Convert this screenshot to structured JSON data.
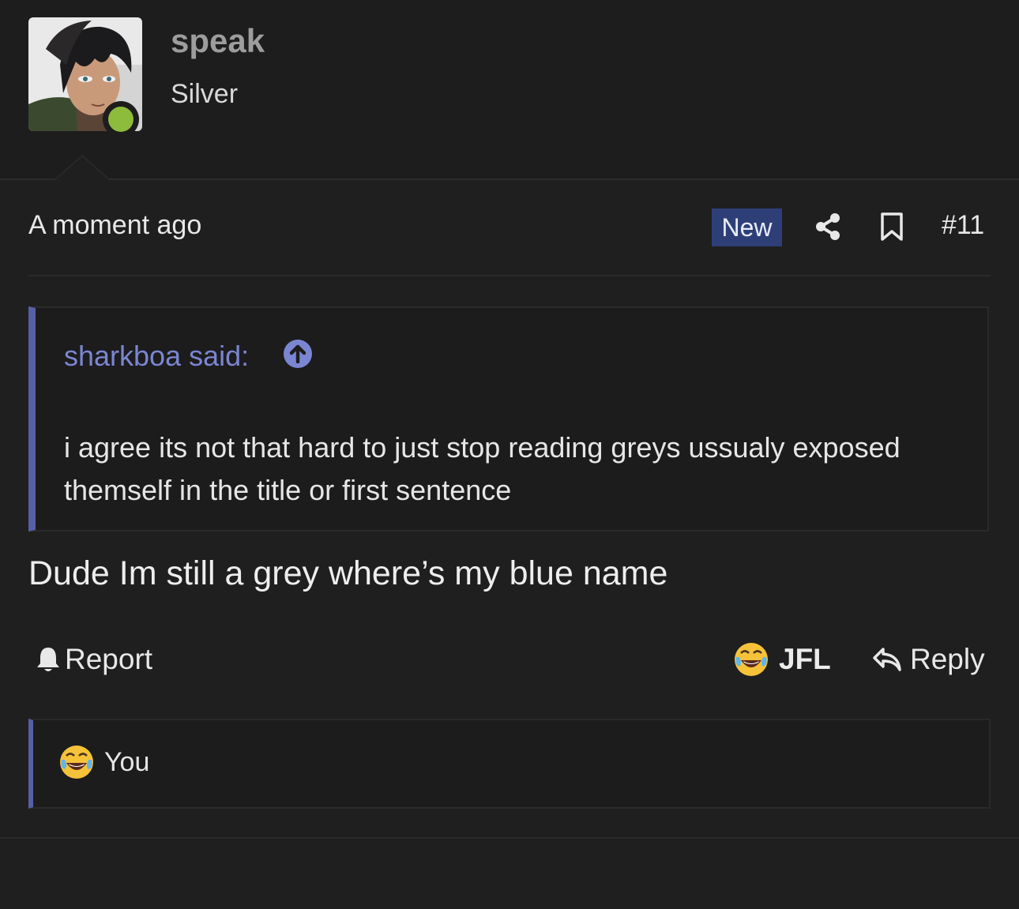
{
  "user": {
    "name": "speak",
    "rank": "Silver",
    "status_color": "#8dbb3b"
  },
  "post": {
    "time": "A moment ago",
    "new_label": "New",
    "number": "#11",
    "body": "Dude Im still a grey where’s my blue name"
  },
  "quote": {
    "author": "sharkboa said:",
    "text": "i agree its not that hard to just stop reading greys ussualy exposed themself in the title or first sentence"
  },
  "actions": {
    "report": "Report",
    "reaction": "JFL",
    "reply": "Reply"
  },
  "reactions_bar": {
    "users": "You"
  },
  "colors": {
    "accent": "#5660a6",
    "link": "#7b86d2",
    "badge": "#2e3f78"
  },
  "icons": [
    "share-icon",
    "bookmark-icon",
    "arrow-up-circle-icon",
    "bell-icon",
    "crying-laughing-emoji-icon",
    "reply-arrow-icon"
  ]
}
